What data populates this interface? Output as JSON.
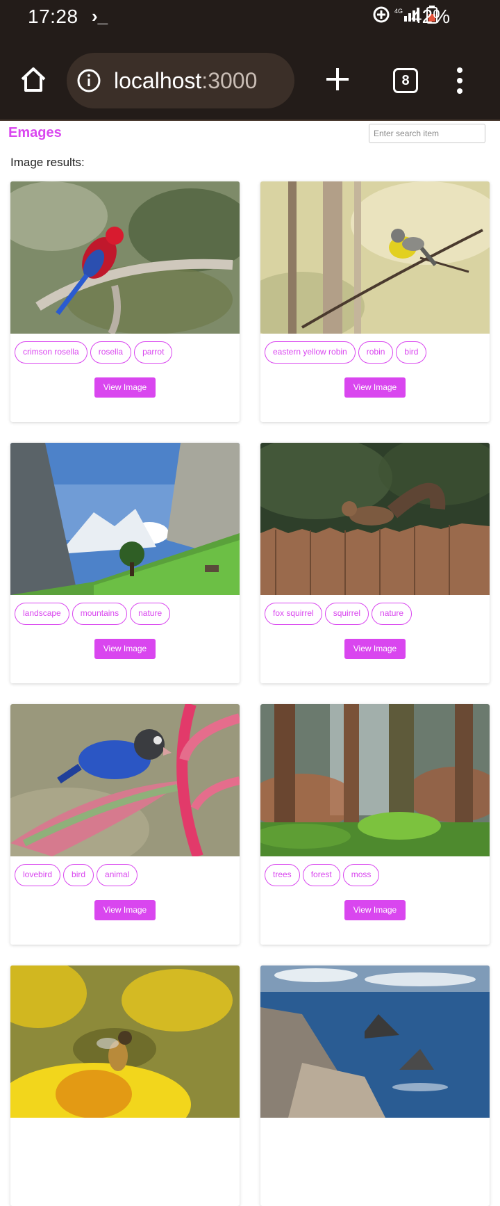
{
  "status": {
    "time": "17:28",
    "terminal": "›_",
    "battery": "42%"
  },
  "browser": {
    "url_host": "localhost",
    "url_port": ":3000",
    "tab_count": "8"
  },
  "app": {
    "brand": "Emages",
    "search_placeholder": "Enter search item",
    "results_label": "Image results:",
    "view_label": "View Image"
  },
  "cards": [
    {
      "tags": [
        "crimson rosella",
        "rosella",
        "parrot"
      ],
      "scene": "parrot-on-branch"
    },
    {
      "tags": [
        "eastern yellow robin",
        "robin",
        "bird"
      ],
      "scene": "robin-on-twig"
    },
    {
      "tags": [
        "landscape",
        "mountains",
        "nature"
      ],
      "scene": "alpine-valley"
    },
    {
      "tags": [
        "fox squirrel",
        "squirrel",
        "nature"
      ],
      "scene": "squirrel-on-fence"
    },
    {
      "tags": [
        "lovebird",
        "bird",
        "animal"
      ],
      "scene": "lovebird-on-flower"
    },
    {
      "tags": [
        "trees",
        "forest",
        "moss"
      ],
      "scene": "misty-forest"
    },
    {
      "tags": [],
      "scene": "bee-on-flower"
    },
    {
      "tags": [],
      "scene": "rocky-coast"
    }
  ],
  "colors": {
    "accent": "#d946ef",
    "chrome": "#231c19"
  }
}
